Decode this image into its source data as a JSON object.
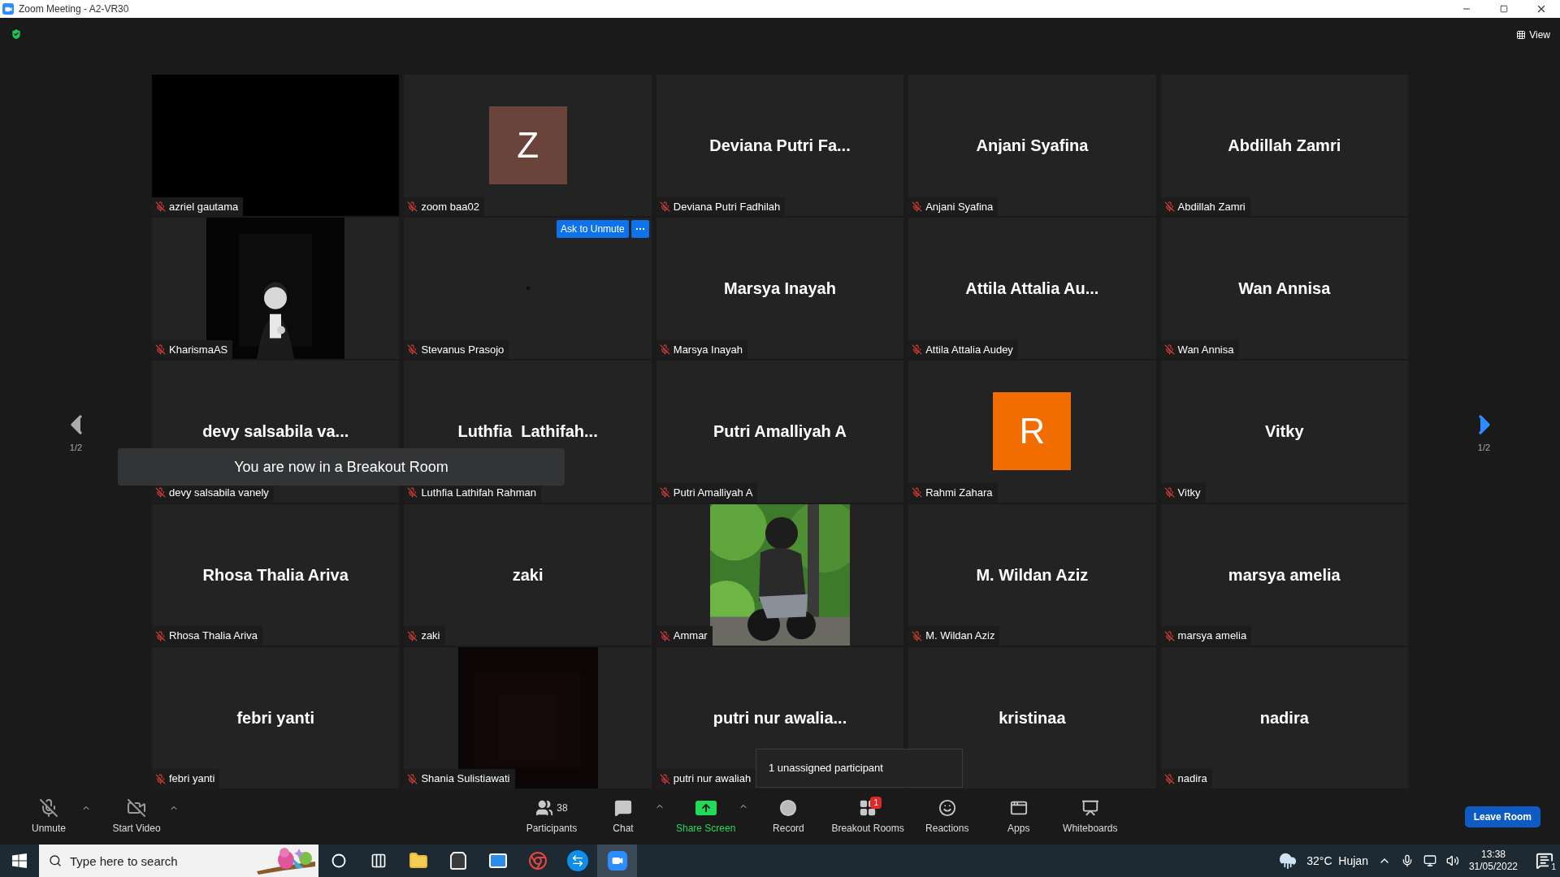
{
  "window": {
    "title": "Zoom Meeting - A2-VR30"
  },
  "view_button": {
    "label": "View"
  },
  "pager": {
    "left": "1/2",
    "right": "1/2"
  },
  "tiles": [
    {
      "kind": "black",
      "label": "azriel gautama",
      "muted": true
    },
    {
      "kind": "avatar",
      "letter": "Z",
      "color": "#6a443a",
      "label": "zoom baa02",
      "muted": true
    },
    {
      "kind": "name",
      "display_name": "Deviana Putri Fa...",
      "label": "Deviana Putri Fadhilah",
      "muted": true
    },
    {
      "kind": "name",
      "display_name": "Anjani Syafina",
      "label": "Anjani Syafina",
      "muted": true
    },
    {
      "kind": "name",
      "display_name": "Abdillah Zamri",
      "label": "Abdillah Zamri",
      "muted": true
    },
    {
      "kind": "picture",
      "label": "KharismaAS",
      "muted": true
    },
    {
      "kind": "empty",
      "label": "Stevanus Prasojo",
      "muted": true,
      "hover_button": "Ask to Unmute"
    },
    {
      "kind": "name",
      "display_name": "Marsya Inayah",
      "label": "Marsya Inayah",
      "muted": true
    },
    {
      "kind": "name",
      "display_name": "Attila Attalia Au...",
      "label": "Attila Attalia Audey",
      "muted": true
    },
    {
      "kind": "name",
      "display_name": "Wan Annisa",
      "label": "Wan Annisa",
      "muted": true
    },
    {
      "kind": "name",
      "display_name": "devy salsabila va...",
      "label": "devy salsabila vanely",
      "muted": true
    },
    {
      "kind": "name",
      "display_name": "Luthfia  Lathifah...",
      "label": "Luthfia Lathifah Rahman",
      "muted": true
    },
    {
      "kind": "name",
      "display_name": "Putri Amalliyah A",
      "label": "Putri Amalliyah A",
      "muted": true
    },
    {
      "kind": "avatar",
      "letter": "R",
      "color": "#f26d00",
      "label": "Rahmi Zahara",
      "muted": true
    },
    {
      "kind": "name",
      "display_name": "Vitky",
      "label": "Vitky",
      "muted": true
    },
    {
      "kind": "name",
      "display_name": "Rhosa Thalia Ariva",
      "label": "Rhosa Thalia Ariva",
      "muted": true
    },
    {
      "kind": "name",
      "display_name": "zaki",
      "label": "zaki",
      "muted": true
    },
    {
      "kind": "picture",
      "label": "Ammar",
      "muted": true
    },
    {
      "kind": "name",
      "display_name": "M. Wildan Aziz",
      "label": "M. Wildan Aziz",
      "muted": true
    },
    {
      "kind": "name",
      "display_name": "marsya amelia",
      "label": "marsya amelia",
      "muted": true
    },
    {
      "kind": "name",
      "display_name": "febri yanti",
      "label": "febri yanti",
      "muted": true
    },
    {
      "kind": "picture",
      "label": "Shania Sulistiawati",
      "muted": true
    },
    {
      "kind": "name",
      "display_name": "putri nur awalia...",
      "label": "putri nur awaliah",
      "muted": true
    },
    {
      "kind": "name",
      "display_name": "kristinaa"
    },
    {
      "kind": "name",
      "display_name": "nadira",
      "label": "nadira",
      "muted": true
    }
  ],
  "toast": "You are now in a Breakout Room",
  "tooltip": "1 unassigned participant",
  "toolbar": {
    "left": [
      {
        "kind": "mic",
        "label": "Unmute"
      },
      {
        "kind": "video",
        "label": "Start Video"
      }
    ],
    "center": [
      {
        "kind": "participants",
        "label": "Participants",
        "count": "38",
        "caret": false
      },
      {
        "kind": "chat",
        "label": "Chat",
        "caret": true
      },
      {
        "kind": "share",
        "label": "Share Screen",
        "caret": true
      },
      {
        "kind": "record",
        "label": "Record",
        "caret": false
      },
      {
        "kind": "breakout",
        "label": "Breakout Rooms",
        "badge": "1",
        "caret": false
      },
      {
        "kind": "reactions",
        "label": "Reactions",
        "caret": false
      },
      {
        "kind": "apps",
        "label": "Apps",
        "caret": false
      },
      {
        "kind": "whiteboards",
        "label": "Whiteboards",
        "caret": false
      }
    ],
    "leave": "Leave Room"
  },
  "taskbar": {
    "search_placeholder": "Type here to search",
    "weather": "32°C  Hujan",
    "time": "13:38",
    "date": "31/05/2022",
    "notifications": "1"
  }
}
